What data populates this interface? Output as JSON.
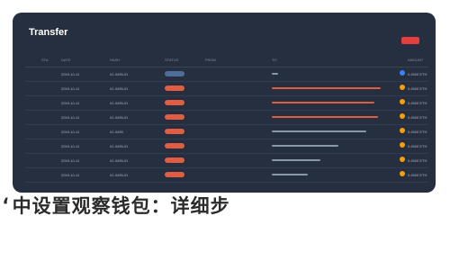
{
  "app": {
    "title": "Transfer"
  },
  "table": {
    "headers": [
      "STA",
      "DATE",
      "HASH",
      "STATUS",
      "FROM",
      "TO",
      "AMOUNT"
    ],
    "rows": [
      {
        "status": "",
        "date": "2019-10-11",
        "hash": "02-3495-01",
        "pill": "#4f6d9a",
        "from": "",
        "bar": "#8a96aa",
        "bar_len": 0.05,
        "dot": "#3b82f6",
        "amount": "0.4500 ETH"
      },
      {
        "status": "",
        "date": "2019-10-11",
        "hash": "02-3495-01",
        "pill": "#e05d44",
        "from": "",
        "bar": "#e05d44",
        "bar_len": 0.9,
        "dot": "#f59e0b",
        "amount": "0.4500 ETH"
      },
      {
        "status": "",
        "date": "2019-10-11",
        "hash": "02-3495-01",
        "pill": "#e05d44",
        "from": "",
        "bar": "#e05d44",
        "bar_len": 0.85,
        "dot": "#f59e0b",
        "amount": "0.4500 ETH"
      },
      {
        "status": "",
        "date": "2019-10-11",
        "hash": "02-3495-01",
        "pill": "#e05d44",
        "from": "",
        "bar": "#e05d44",
        "bar_len": 0.88,
        "dot": "#f59e0b",
        "amount": "0.4500 ETH"
      },
      {
        "status": "",
        "date": "2019-10-11",
        "hash": "02-3495",
        "pill": "#e05d44",
        "from": "",
        "bar": "#8a96aa",
        "bar_len": 0.78,
        "dot": "#f59e0b",
        "amount": "0.4500 ETH"
      },
      {
        "status": "",
        "date": "2019-10-11",
        "hash": "02-3495-01",
        "pill": "#e05d44",
        "from": "",
        "bar": "#8a96aa",
        "bar_len": 0.55,
        "dot": "#f59e0b",
        "amount": "0.4500 ETH"
      },
      {
        "status": "",
        "date": "2019-10-11",
        "hash": "02-3495-01",
        "pill": "#e05d44",
        "from": "",
        "bar": "#8a96aa",
        "bar_len": 0.4,
        "dot": "#f59e0b",
        "amount": "0.4500 ETH"
      },
      {
        "status": "",
        "date": "2019-10-11",
        "hash": "02-3495-01",
        "pill": "#e05d44",
        "from": "",
        "bar": "#8a96aa",
        "bar_len": 0.3,
        "dot": "#f59e0b",
        "amount": "0.4500 ETH"
      }
    ]
  },
  "banner": {
    "text": "‘中设置观察钱包：详细步"
  },
  "colors": {
    "accent": "#e53e3e",
    "panel": "#262f3f"
  }
}
